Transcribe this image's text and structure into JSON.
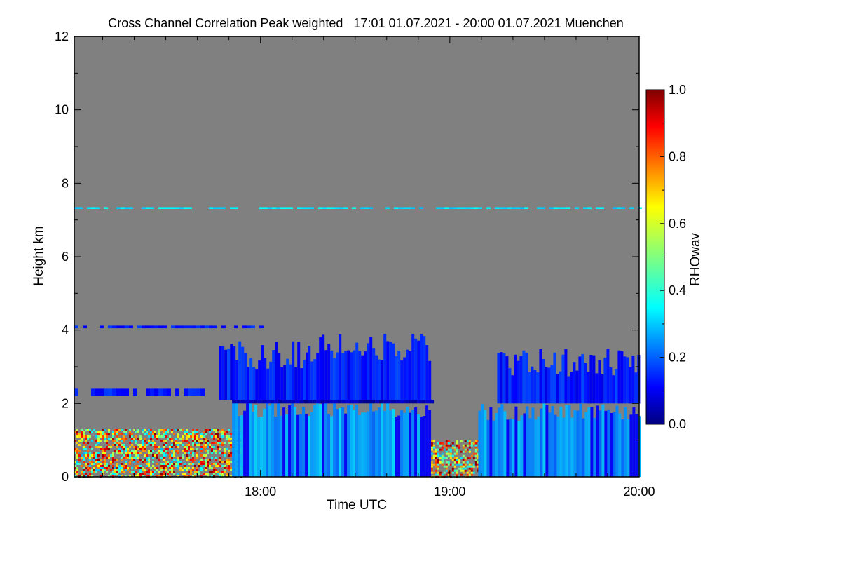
{
  "chart_data": {
    "type": "heatmap",
    "title": "Cross Channel Correlation Peak weighted   17:01 01.07.2021 - 20:00 01.07.2021 Muenchen",
    "xlabel": "Time UTC",
    "ylabel": "Height km",
    "colorbar_label": "RHOwav",
    "x_range_hours": [
      17.0167,
      20.0
    ],
    "x_ticks": [
      {
        "value": 18.0,
        "label": "18:00"
      },
      {
        "value": 19.0,
        "label": "19:00"
      },
      {
        "value": 20.0,
        "label": "20:00"
      }
    ],
    "y_range": [
      0,
      12
    ],
    "y_ticks": [
      {
        "value": 0,
        "label": "0"
      },
      {
        "value": 2,
        "label": "2"
      },
      {
        "value": 4,
        "label": "4"
      },
      {
        "value": 6,
        "label": "6"
      },
      {
        "value": 8,
        "label": "8"
      },
      {
        "value": 10,
        "label": "10"
      },
      {
        "value": 12,
        "label": "12"
      }
    ],
    "colorbar_range": [
      0.0,
      1.0
    ],
    "colorbar_ticks": [
      {
        "value": 0.0,
        "label": "0.0"
      },
      {
        "value": 0.2,
        "label": "0.2"
      },
      {
        "value": 0.4,
        "label": "0.4"
      },
      {
        "value": 0.6,
        "label": "0.6"
      },
      {
        "value": 0.8,
        "label": "0.8"
      },
      {
        "value": 1.0,
        "label": "1.0"
      }
    ],
    "colormap": "jet",
    "no_data_color": "#808080",
    "features": [
      {
        "kind": "noise_layer",
        "x": [
          17.0167,
          17.9
        ],
        "y": [
          0.0,
          1.3
        ],
        "rho": [
          0.3,
          1.0
        ]
      },
      {
        "kind": "noise_layer",
        "x": [
          18.9,
          19.15
        ],
        "y": [
          0.0,
          1.0
        ],
        "rho": [
          0.3,
          1.0
        ]
      },
      {
        "kind": "precip_column",
        "x": [
          17.85,
          18.9
        ],
        "y": [
          0.0,
          2.1
        ],
        "rho": 0.28
      },
      {
        "kind": "precip_column",
        "x": [
          19.15,
          20.0
        ],
        "y": [
          0.0,
          2.0
        ],
        "rho": 0.27
      },
      {
        "kind": "cloud",
        "x": [
          17.78,
          18.25
        ],
        "y": [
          2.1,
          3.7
        ],
        "rho": 0.15
      },
      {
        "kind": "cloud",
        "x": [
          18.25,
          18.9
        ],
        "y": [
          2.1,
          3.9
        ],
        "rho": 0.15
      },
      {
        "kind": "cloud",
        "x": [
          19.25,
          20.0
        ],
        "y": [
          2.0,
          3.5
        ],
        "rho": 0.15
      },
      {
        "kind": "thin_layer",
        "x": [
          17.0167,
          20.0
        ],
        "y": [
          7.3,
          7.35
        ],
        "rho": 0.35
      },
      {
        "kind": "thin_layer",
        "x": [
          17.0167,
          18.0
        ],
        "y": [
          4.05,
          4.12
        ],
        "rho": 0.15
      },
      {
        "kind": "thin_layer",
        "x": [
          17.0167,
          17.7
        ],
        "y": [
          2.2,
          2.4
        ],
        "rho": 0.15
      },
      {
        "kind": "melting_layer",
        "x": [
          17.85,
          18.9
        ],
        "y": [
          2.0,
          2.1
        ],
        "rho": 0.05
      }
    ]
  }
}
